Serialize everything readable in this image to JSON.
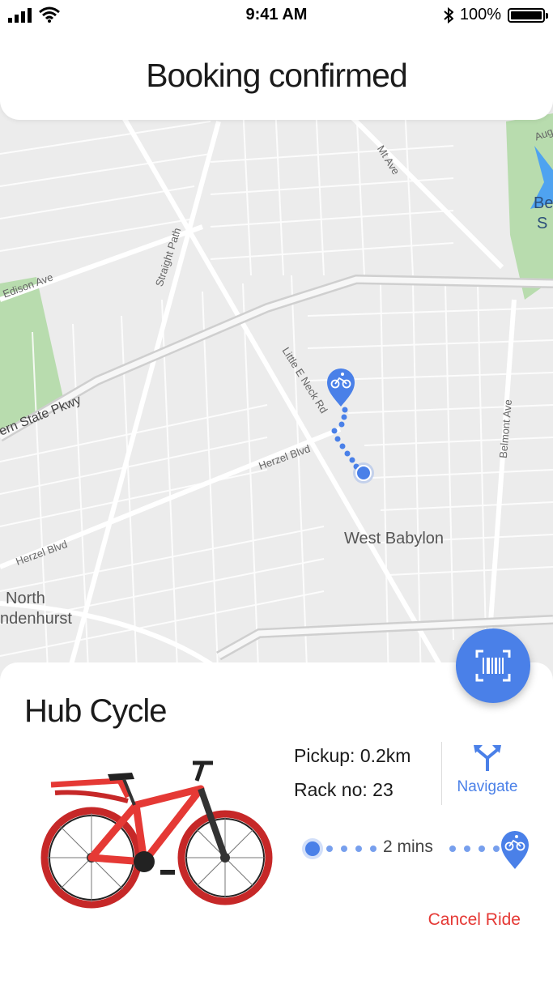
{
  "status_bar": {
    "time": "9:41 AM",
    "battery": "100%"
  },
  "header": {
    "title": "Booking confirmed"
  },
  "map": {
    "labels": {
      "mt_ave": "Mt Ave",
      "edison_ave": "Edison Ave",
      "straight_path": "Straight Path",
      "little_e_neck_rd": "Little E Neck Rd",
      "state_pkwy": "ern State Pkwy",
      "herzel_blvd_1": "Herzel Blvd",
      "herzel_blvd_2": "Herzel Blvd",
      "belmont_ave": "Belmont Ave",
      "west_babylon": "West Babylon",
      "north": "North",
      "lindenhurst": "ndenhurst",
      "be": "Be",
      "s": "S",
      "aug": "Aug"
    }
  },
  "fab": {
    "icon": "barcode-scan-icon"
  },
  "sheet": {
    "bike_name": "Hub Cycle",
    "pickup": "Pickup: 0.2km",
    "rack": "Rack no: 23",
    "navigate_label": "Navigate",
    "eta": "2 mins",
    "cancel_label": "Cancel Ride"
  },
  "colors": {
    "accent": "#4a80e8",
    "cancel": "#e53935",
    "map_bg": "#ececec",
    "park": "#b8dcae",
    "water": "#4fa3f0"
  }
}
